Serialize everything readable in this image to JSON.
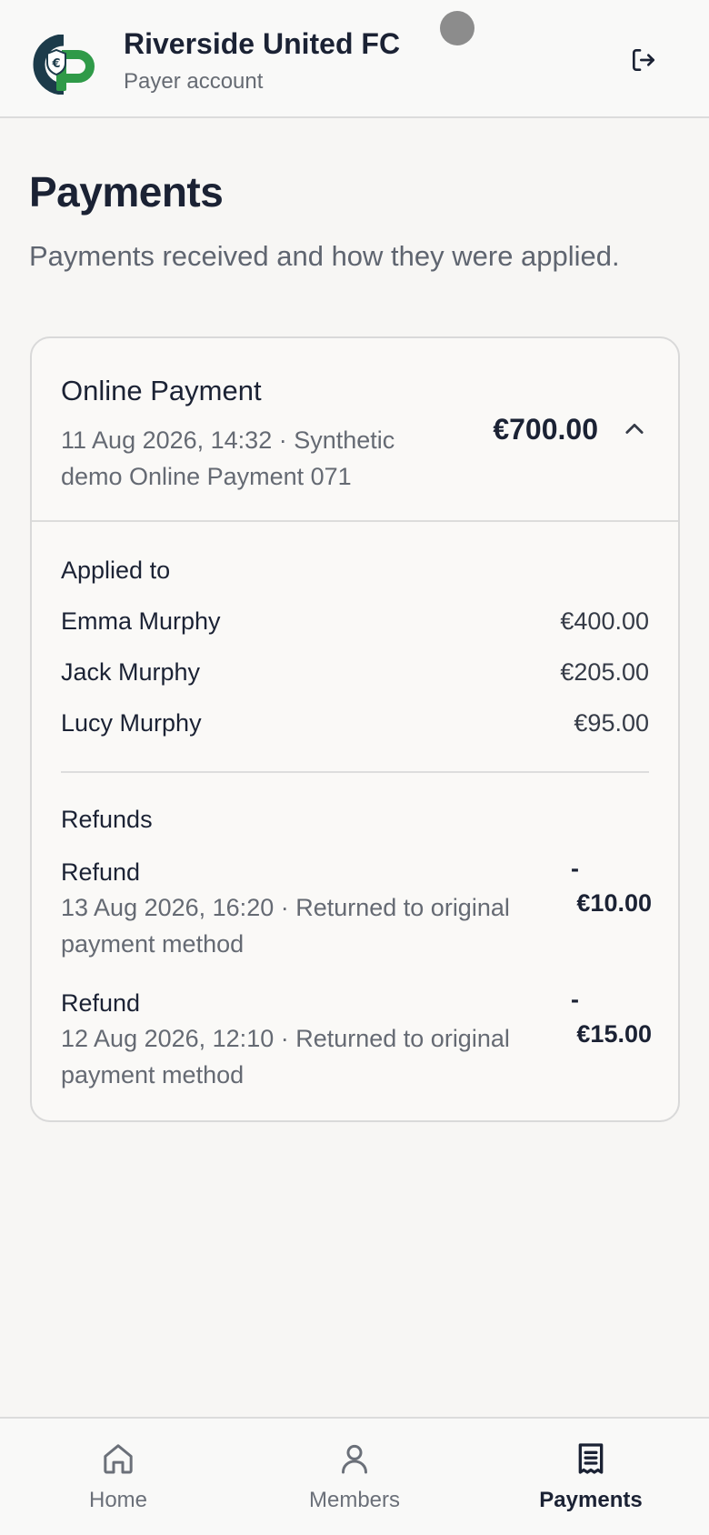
{
  "header": {
    "club_name": "Riverside United FC",
    "account_type": "Payer account"
  },
  "page": {
    "title": "Payments",
    "subtitle": "Payments received and how they were applied."
  },
  "payment": {
    "method": "Online Payment",
    "detail": "11 Aug 2026, 14:32 · Synthetic demo Online Payment 071",
    "amount": "€700.00",
    "expanded": true,
    "applied_to_label": "Applied to",
    "applied_to": [
      {
        "name": "Emma Murphy",
        "amount": "€400.00"
      },
      {
        "name": "Jack Murphy",
        "amount": "€205.00"
      },
      {
        "name": "Lucy Murphy",
        "amount": "€95.00"
      }
    ],
    "refunds_label": "Refunds",
    "refunds": [
      {
        "title": "Refund",
        "detail": "13 Aug 2026, 16:20 · Returned to original payment method",
        "sign": "-",
        "amount": "€10.00"
      },
      {
        "title": "Refund",
        "detail": "12 Aug 2026, 12:10 · Returned to original payment method",
        "sign": "-",
        "amount": "€15.00"
      }
    ]
  },
  "nav": {
    "items": [
      {
        "label": "Home",
        "icon": "home-icon",
        "active": false
      },
      {
        "label": "Members",
        "icon": "user-icon",
        "active": false
      },
      {
        "label": "Payments",
        "icon": "receipt-icon",
        "active": true
      }
    ]
  },
  "colors": {
    "brand_dark": "#1c3b4a",
    "brand_green": "#2f9a48",
    "text_primary": "#1b2234",
    "text_secondary": "#656a73",
    "background": "#f7f6f4"
  }
}
